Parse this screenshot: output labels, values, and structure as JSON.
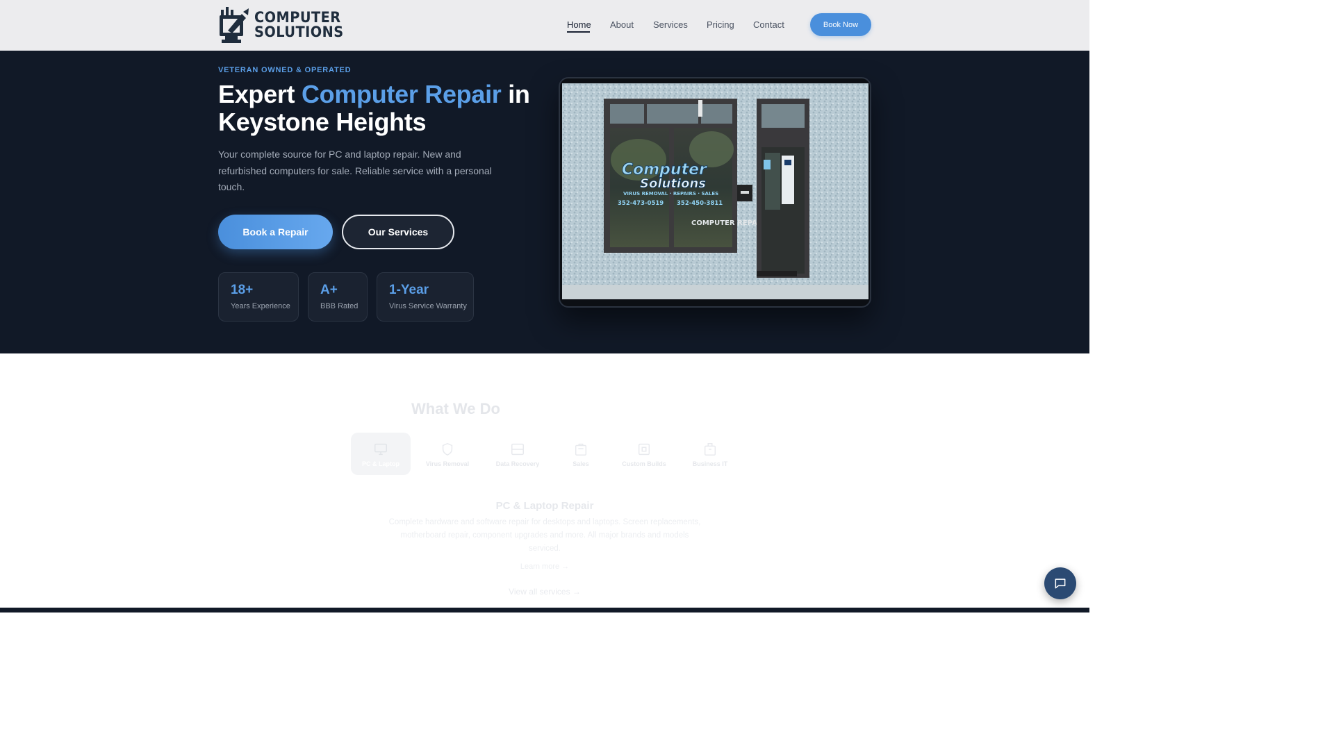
{
  "header": {
    "logo_line1": "COMPUTER",
    "logo_line2": "SOLUTIONS",
    "nav": [
      "Home",
      "About",
      "Services",
      "Pricing",
      "Contact"
    ],
    "active_nav": "Home",
    "cta_label": "Book Now"
  },
  "hero": {
    "eyebrow": "VETERAN OWNED & OPERATED",
    "title_pre": "Expert ",
    "title_accent": "Computer Repair",
    "title_post": " in Keystone Heights",
    "subtitle": "Your complete source for PC and laptop repair. New and refurbished computers for sale. Reliable service with a personal touch.",
    "primary_button": "Book a Repair",
    "secondary_button": "Our Services",
    "stats": [
      {
        "value": "18+",
        "label": "Years Experience"
      },
      {
        "value": "A+",
        "label": "BBB Rated"
      },
      {
        "value": "1-Year",
        "label": "Virus Service Warranty"
      }
    ],
    "photo": {
      "sign_line1": "Computer",
      "sign_line2": "Solutions",
      "sign_services": "VIRUS REMOVAL · REPAIRS · SALES",
      "sign_phone1": "352-473-0519",
      "sign_phone2": "352-450-3811",
      "sign_repair": "COMPUTER REPAIR"
    }
  },
  "services": {
    "title": "What We Do",
    "tabs": [
      {
        "label": "PC & Laptop",
        "icon": "monitor-icon"
      },
      {
        "label": "Virus Removal",
        "icon": "shield-icon"
      },
      {
        "label": "Data Recovery",
        "icon": "hard-drive-icon"
      },
      {
        "label": "Sales",
        "icon": "shopping-bag-icon"
      },
      {
        "label": "Custom Builds",
        "icon": "cpu-icon"
      },
      {
        "label": "Business IT",
        "icon": "briefcase-icon"
      }
    ],
    "active_tab": "PC & Laptop",
    "panel_title": "PC & Laptop Repair",
    "panel_desc": "Complete hardware and software repair for desktops and laptops. Screen replacements, motherboard repair, component upgrades and more. All major brands and models serviced.",
    "learn_more": "Learn more →",
    "view_all": "View all services →"
  },
  "colors": {
    "accent": "#4a8fdc",
    "hero_bg": "#111927",
    "header_bg": "#ececee"
  },
  "chat": {
    "icon": "chat-bubble-icon"
  }
}
